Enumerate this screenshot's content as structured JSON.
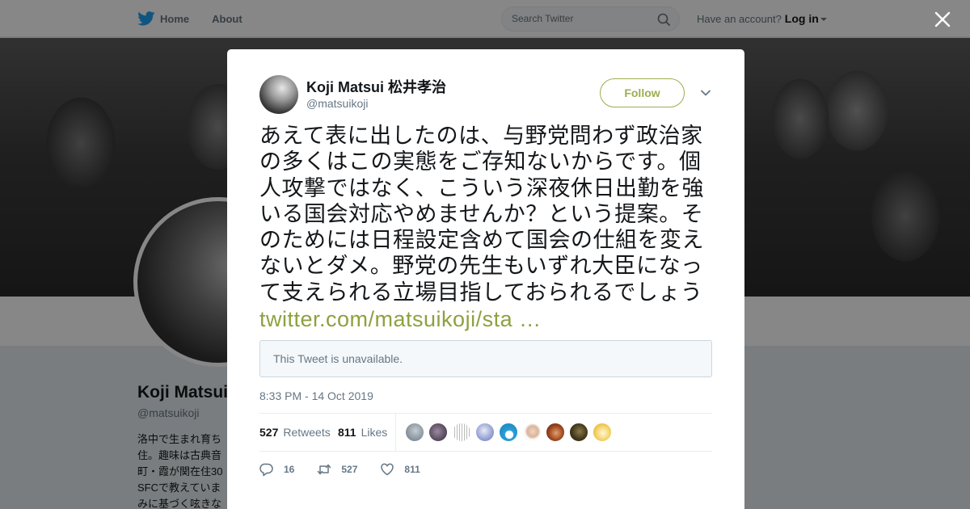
{
  "nav": {
    "home_label": "Home",
    "about_label": "About",
    "search_placeholder": "Search Twitter",
    "account_prompt": "Have an account?",
    "login_label": "Log in"
  },
  "profile": {
    "name": "Koji Matsui",
    "handle": "@matsuikoji",
    "bio_lines": [
      "洛中で生まれ育ち",
      "住。趣味は古典音",
      "町・霞が関在住30",
      "SFCで教えていま",
      "みに基づく呟きな"
    ]
  },
  "modal": {
    "author_name": "Koji Matsui 松井孝治",
    "author_handle": "@matsuikoji",
    "follow_label": "Follow",
    "tweet_text": "あえて表に出したのは、与野党問わず政治家の多くはこの実態をご存知ないからです。個人攻撃ではなく、こういう深夜休日出勤を強いる国会対応やめませんか？という提案。そのためには日程設定含めて国会の仕組を変えないとダメ。野党の先生もいずれ大臣になって支えられる立場目指しておられるでしょう ",
    "tweet_link": "twitter.com/matsuikoji/sta …",
    "unavailable_text": "This Tweet is unavailable.",
    "timestamp": "8:33 PM - 14 Oct 2019",
    "retweets_count": "527",
    "retweets_label": "Retweets",
    "likes_count": "811",
    "likes_label": "Likes",
    "reply_count": "16",
    "retweet_action_count": "527",
    "like_action_count": "811"
  },
  "icons": {
    "logo": "twitter-bird-icon",
    "search": "search-icon",
    "close": "close-icon",
    "chevron": "chevron-down-icon",
    "reply": "reply-icon",
    "retweet": "retweet-icon",
    "like": "heart-icon"
  },
  "colors": {
    "accent": "#9dad50",
    "link": "#8da13f",
    "twitter_blue": "#1da1f2",
    "muted": "#657786"
  }
}
